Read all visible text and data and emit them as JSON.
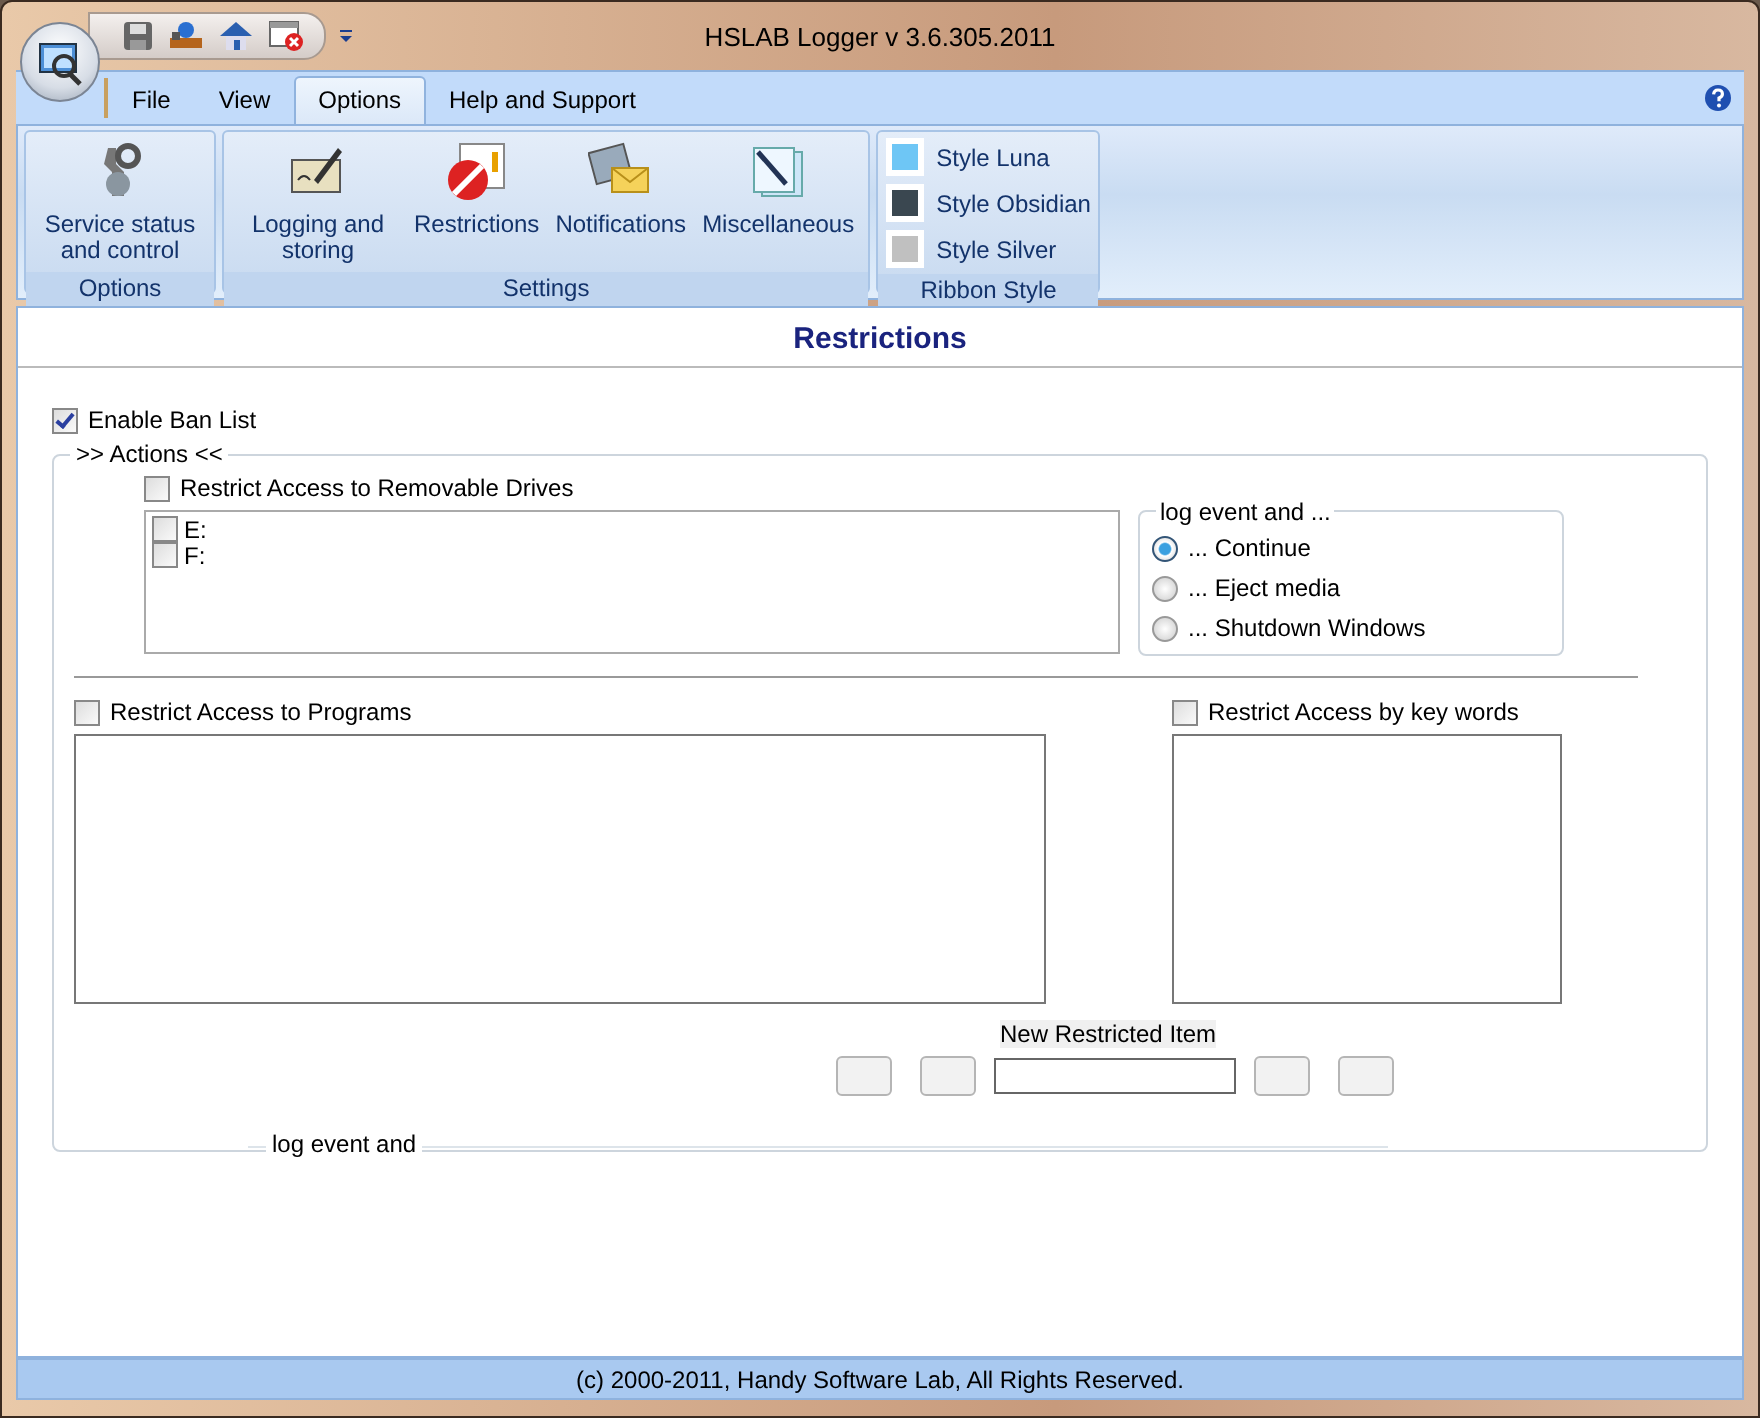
{
  "window": {
    "title": "HSLAB Logger v 3.6.305.2011"
  },
  "menu_tabs": [
    {
      "label": "File",
      "selected": false
    },
    {
      "label": "View",
      "selected": false
    },
    {
      "label": "Options",
      "selected": true
    },
    {
      "label": "Help and Support",
      "selected": false
    }
  ],
  "ribbon_groups": [
    {
      "kind": "buttons",
      "title": "Options",
      "items": [
        {
          "label": "Service status and control"
        }
      ]
    },
    {
      "kind": "buttons",
      "title": "Settings",
      "items": [
        {
          "label": "Logging and storing"
        },
        {
          "label": "Restrictions"
        },
        {
          "label": "Notifications"
        },
        {
          "label": "Miscellaneous"
        }
      ]
    },
    {
      "kind": "styles",
      "title": "Ribbon Style",
      "items": [
        {
          "label": "Style Luna",
          "color": "#6ec6f5"
        },
        {
          "label": "Style Obsidian",
          "color": "#3a4750"
        },
        {
          "label": "Style Silver",
          "color": "#c0c0c0"
        }
      ]
    }
  ],
  "panel": {
    "title": "Restrictions",
    "enable_ban_list": {
      "label": "Enable Ban List",
      "checked": true
    },
    "actions": {
      "legend": ">> Actions <<",
      "removable_drives": {
        "label": "Restrict Access to Removable Drives",
        "checked": false,
        "drives": [
          {
            "label": "E:",
            "checked": false
          },
          {
            "label": "F:",
            "checked": false
          }
        ]
      },
      "log_event": {
        "legend": "log event and ...",
        "options": [
          {
            "label": "... Continue",
            "selected": true
          },
          {
            "label": "... Eject media",
            "selected": false
          },
          {
            "label": "... Shutdown Windows",
            "selected": false
          }
        ]
      },
      "programs": {
        "label": "Restrict Access to Programs",
        "checked": false
      },
      "keywords": {
        "label": "Restrict Access by key words",
        "checked": false
      },
      "new_item": {
        "label": "New Restricted Item"
      },
      "second_log_event": {
        "legend": "log event and"
      }
    }
  },
  "status_bar": {
    "text": "(c) 2000-2011, Handy Software Lab, All Rights Reserved."
  }
}
